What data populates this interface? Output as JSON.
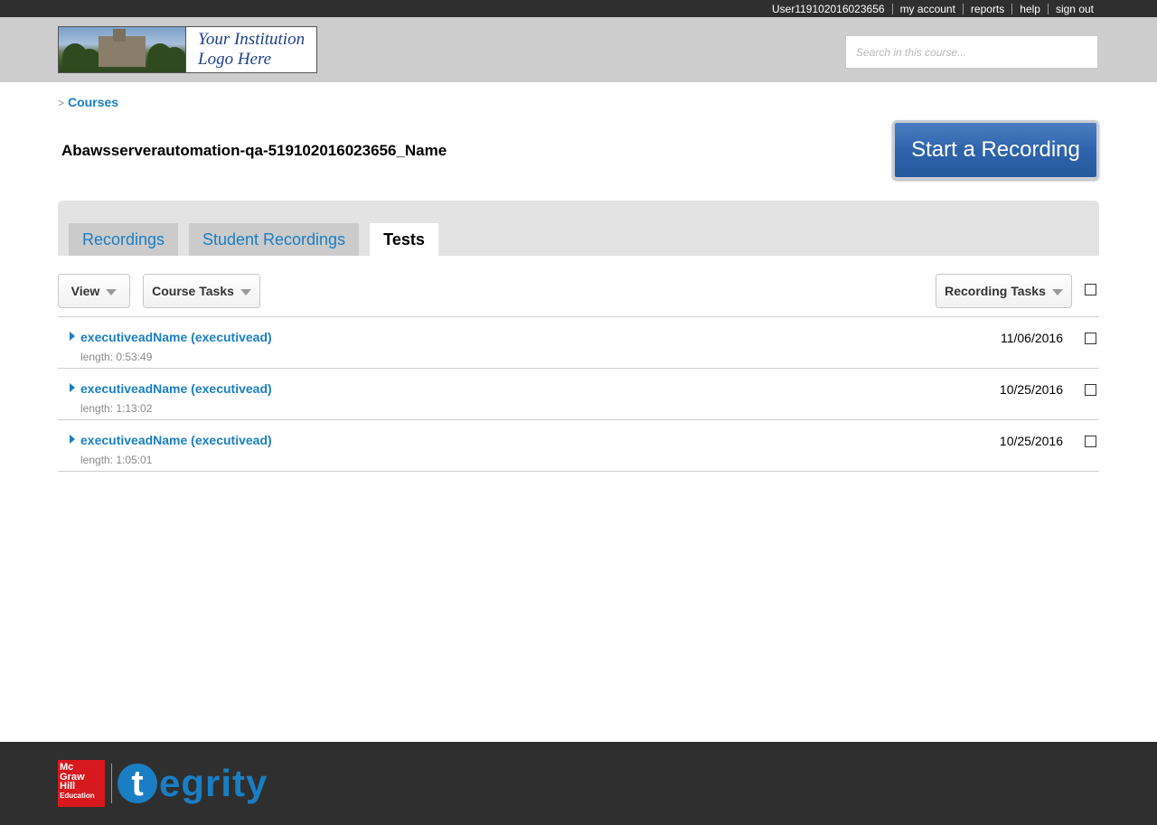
{
  "topnav": {
    "username": "User119102016023656",
    "my_account": "my account",
    "reports": "reports",
    "help": "help",
    "sign_out": "sign out"
  },
  "header": {
    "logo_text_line1": "Your Institution",
    "logo_text_line2": "Logo Here",
    "search_placeholder": "Search in this course..."
  },
  "breadcrumb": {
    "separator": ">",
    "link": "Courses"
  },
  "course": {
    "title": "Abawsserverautomation-qa-519102016023656_Name",
    "start_button": "Start a Recording"
  },
  "tabs": [
    {
      "label": "Recordings",
      "active": false
    },
    {
      "label": "Student Recordings",
      "active": false
    },
    {
      "label": "Tests",
      "active": true
    }
  ],
  "toolbar": {
    "view": "View",
    "course_tasks": "Course Tasks",
    "recording_tasks": "Recording Tasks"
  },
  "recordings": [
    {
      "title": "executiveadName (executivead)",
      "length": "length: 0:53:49",
      "date": "11/06/2016"
    },
    {
      "title": "executiveadName (executivead)",
      "length": "length: 1:13:02",
      "date": "10/25/2016"
    },
    {
      "title": "executiveadName (executivead)",
      "length": "length: 1:05:01",
      "date": "10/25/2016"
    }
  ],
  "footer": {
    "mh_logo_lines": [
      "Mc",
      "Graw",
      "Hill",
      "Education"
    ],
    "brand_t": "t",
    "brand_rest": "egrity"
  },
  "colors": {
    "link_blue": "#1a7ec4",
    "button_blue": "#2f64ab",
    "topbar": "#2f2f2f",
    "header": "#cdcdcd",
    "mh_red": "#d7191f"
  }
}
